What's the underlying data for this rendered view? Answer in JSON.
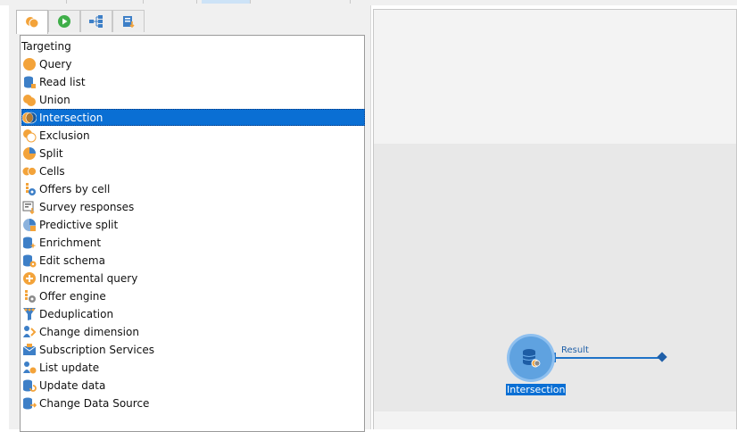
{
  "colors": {
    "selection": "#0a6fd4",
    "accent_orange": "#f3a33a",
    "accent_blue": "#3d7fc7",
    "accent_green": "#3fae49"
  },
  "tabs": [
    {
      "icon": "targeting-activities-icon",
      "active": true
    },
    {
      "icon": "flow-control-icon",
      "active": false
    },
    {
      "icon": "actions-icon",
      "active": false
    },
    {
      "icon": "data-import-icon",
      "active": false
    }
  ],
  "list": {
    "header": "Targeting",
    "items": [
      {
        "label": "Query",
        "icon": "query-icon"
      },
      {
        "label": "Read list",
        "icon": "read-list-icon"
      },
      {
        "label": "Union",
        "icon": "union-icon"
      },
      {
        "label": "Intersection",
        "icon": "intersection-icon",
        "selected": true
      },
      {
        "label": "Exclusion",
        "icon": "exclusion-icon"
      },
      {
        "label": "Split",
        "icon": "split-icon"
      },
      {
        "label": "Cells",
        "icon": "cells-icon"
      },
      {
        "label": "Offers by cell",
        "icon": "offers-by-cell-icon"
      },
      {
        "label": "Survey responses",
        "icon": "survey-responses-icon"
      },
      {
        "label": "Predictive split",
        "icon": "predictive-split-icon"
      },
      {
        "label": "Enrichment",
        "icon": "enrichment-icon"
      },
      {
        "label": "Edit schema",
        "icon": "edit-schema-icon"
      },
      {
        "label": "Incremental query",
        "icon": "incremental-query-icon"
      },
      {
        "label": "Offer engine",
        "icon": "offer-engine-icon"
      },
      {
        "label": "Deduplication",
        "icon": "deduplication-icon"
      },
      {
        "label": "Change dimension",
        "icon": "change-dimension-icon"
      },
      {
        "label": "Subscription Services",
        "icon": "subscription-services-icon"
      },
      {
        "label": "List update",
        "icon": "list-update-icon"
      },
      {
        "label": "Update data",
        "icon": "update-data-icon"
      },
      {
        "label": "Change Data Source",
        "icon": "change-data-source-icon"
      }
    ]
  },
  "canvas": {
    "node_label": "Intersection",
    "node_icon": "intersection-database-icon",
    "transition_label": "Result"
  }
}
